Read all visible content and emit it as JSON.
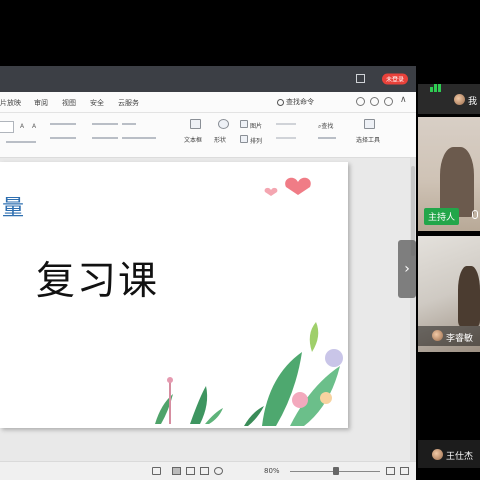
{
  "titlebar": {
    "login_badge": "未登录"
  },
  "menubar": {
    "items": [
      "片放映",
      "审阅",
      "视图",
      "安全",
      "云服务"
    ],
    "search_label": "查找命令"
  },
  "ribbon": {
    "text_box": "文本框",
    "shapes": "形状",
    "picture": "图片",
    "arrange": "排列",
    "find": "查找",
    "select_tool": "选择工具"
  },
  "slide": {
    "title_fragment": "量",
    "title": "复习课"
  },
  "statusbar": {
    "zoom": "80%"
  },
  "participants": {
    "self_name": "我",
    "host_badge": "主持人",
    "li_name": "李睿敏",
    "wang_name": "王仕杰"
  },
  "colors": {
    "title_fragment": "#2f6fb0",
    "host_badge": "#22a64a",
    "login_badge": "#e8413a",
    "signal": "#2ecc52"
  }
}
